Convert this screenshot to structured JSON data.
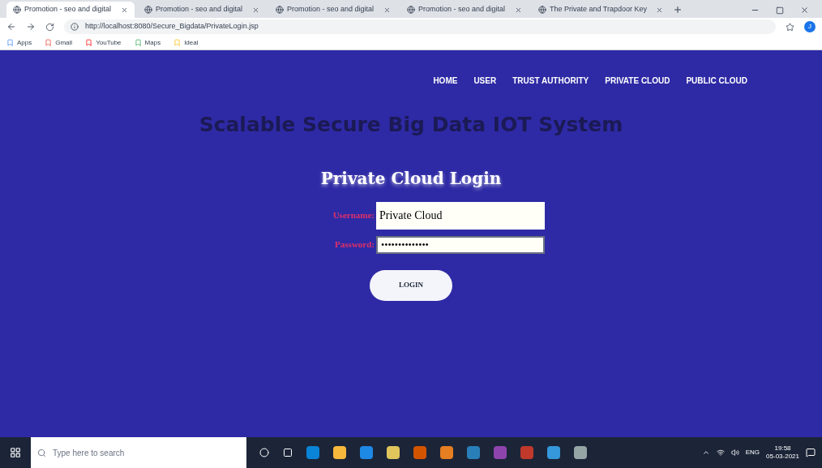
{
  "browser": {
    "tabs": [
      {
        "title": "Promotion - seo and digital",
        "selected": true
      },
      {
        "title": "Promotion - seo and digital",
        "selected": false
      },
      {
        "title": "Promotion - seo and digital",
        "selected": false
      },
      {
        "title": "Promotion - seo and digital",
        "selected": false
      },
      {
        "title": "The Private and Trapdoor Key",
        "selected": false
      }
    ],
    "address": "http://localhost:8080/Secure_Bigdata/PrivateLogin.jsp",
    "profile_initial": "J",
    "bookmarks": [
      "Apps",
      "Gmail",
      "YouTube",
      "Maps",
      "Ideal"
    ]
  },
  "nav": [
    {
      "label": "HOME"
    },
    {
      "label": "USER"
    },
    {
      "label": "TRUST AUTHORITY"
    },
    {
      "label": "PRIVATE CLOUD"
    },
    {
      "label": "PUBLIC CLOUD"
    }
  ],
  "site_title": "Scalable Secure Big Data IOT System",
  "form": {
    "title": "Private Cloud Login",
    "username": {
      "label": "Username:",
      "value": "Private Cloud"
    },
    "password": {
      "label": "Password:",
      "masked_value": "••••••••••••••"
    },
    "button": "LOGIN"
  },
  "taskbar": {
    "search_placeholder": "Type here to search",
    "language": "ENG",
    "time": "19:58",
    "date": "05-03-2021"
  }
}
